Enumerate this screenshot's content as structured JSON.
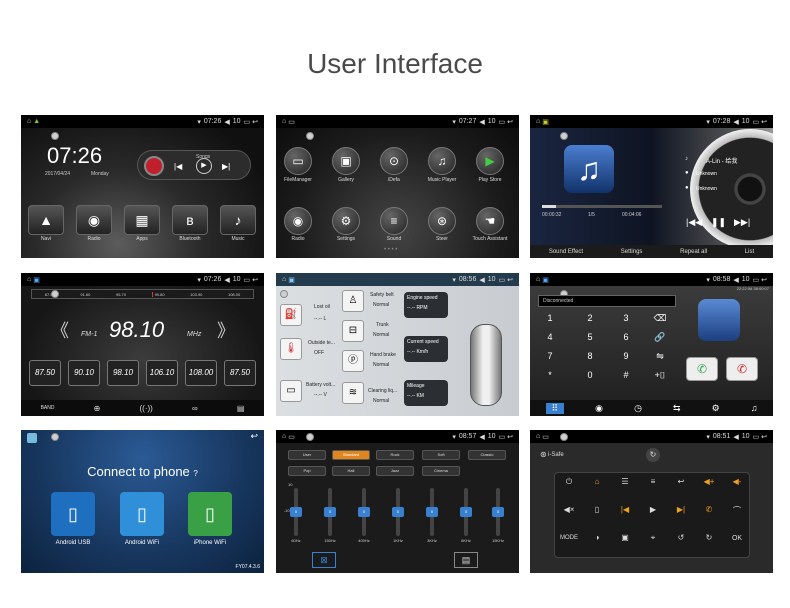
{
  "title": "User Interface",
  "colors": {
    "accent_blue": "#3a80d0",
    "call_green": "#2ea84a",
    "hangup_red": "#d02828",
    "icon_orange": "#f0a020"
  },
  "tile1": {
    "time": "07:26",
    "volume": "10",
    "clock": "07:26",
    "date": "2017/04/24",
    "day": "Monday",
    "songs_label": "Songs",
    "icons": [
      {
        "name": "navi",
        "label": "Navi",
        "glyph": "▲"
      },
      {
        "name": "radio",
        "label": "Radio",
        "glyph": "◉"
      },
      {
        "name": "apps",
        "label": "Apps",
        "glyph": "▦"
      },
      {
        "name": "bluetooth",
        "label": "Bluetooth",
        "glyph": "ʙ"
      },
      {
        "name": "music",
        "label": "Music",
        "glyph": "♪"
      }
    ]
  },
  "tile2": {
    "time": "07:27",
    "volume": "10",
    "apps_row1": [
      {
        "name": "file-manager",
        "label": "FileManager",
        "glyph": "▭"
      },
      {
        "name": "gallery",
        "label": "Gallery",
        "glyph": "▣"
      },
      {
        "name": "idrive",
        "label": "iDefa",
        "glyph": "⊙"
      },
      {
        "name": "music-player",
        "label": "Music Player",
        "glyph": "♫"
      },
      {
        "name": "play-store",
        "label": "Play Store",
        "glyph": "▶"
      }
    ],
    "apps_row2": [
      {
        "name": "radio",
        "label": "Radio",
        "glyph": "◉"
      },
      {
        "name": "settings",
        "label": "Settings",
        "glyph": "⚙"
      },
      {
        "name": "sound",
        "label": "Sound",
        "glyph": "≡"
      },
      {
        "name": "steer",
        "label": "Steer",
        "glyph": "⊛"
      },
      {
        "name": "touch-assistant",
        "label": "Touch Assistant",
        "glyph": "☚"
      }
    ]
  },
  "tile3": {
    "time": "07:28",
    "volume": "10",
    "artist": "A-Lin - 给我",
    "info1": "Unknown",
    "info2": "Unknown",
    "elapsed": "00:00:32",
    "track": "1/5",
    "duration": "00:04:06",
    "tabs": [
      "Sound Effect",
      "Settings",
      "Repeat all",
      "List"
    ]
  },
  "tile4": {
    "time": "07:26",
    "volume": "10",
    "scale": [
      "87.50",
      "91.60",
      "95.70",
      "99.80",
      "103.90",
      "108.00"
    ],
    "band": "FM-1",
    "frequency": "98.10",
    "unit": "MHz",
    "presets": [
      "87.50",
      "90.10",
      "98.10",
      "106.10",
      "108.00",
      "87.50"
    ],
    "bottom_band": "BAND"
  },
  "tile5": {
    "time": "08:56",
    "volume": "10",
    "lost_oil": "Lost oil",
    "lost_oil_val": "--.-- L",
    "outside_temp": "Outside te...",
    "outside_temp_val": "OFF",
    "battery_volt": "Battery volt...",
    "battery_volt_val": "--.-- V",
    "safety_belt": "Safety belt",
    "safety_belt_val": "Normal",
    "trunk": "Trunk",
    "trunk_val": "Normal",
    "hand_brake": "Hand brake",
    "hand_brake_val": "Normal",
    "clearing": "Clearing liq...",
    "clearing_val": "Normal",
    "engine_speed": "Engine speed",
    "engine_speed_val": "--.-- RPM",
    "current_speed": "Current speed",
    "current_speed_val": "--.-- Km/h",
    "mileage": "Mileage",
    "mileage_val": "--.-- KM"
  },
  "tile6": {
    "time": "08:58",
    "volume": "10",
    "datetime": "22:22:58 38:00:07",
    "status": "Disconnected",
    "keys": [
      "1",
      "2",
      "3",
      "⌫",
      "4",
      "5",
      "6",
      "🔗",
      "7",
      "8",
      "9",
      "⇋",
      "*",
      "0",
      "#",
      "+⌷"
    ]
  },
  "tile7": {
    "title": "Connect to phone",
    "options": [
      {
        "name": "android-usb",
        "label": "Android USB",
        "color": "#1e6fc0"
      },
      {
        "name": "android-wifi",
        "label": "Android WiFi",
        "color": "#2f8fd8"
      },
      {
        "name": "iphone-wifi",
        "label": "iPhone WiFi",
        "color": "#3aa046"
      }
    ],
    "version": "FY07.4.3.6"
  },
  "tile8": {
    "time": "08:57",
    "volume": "10",
    "presets_row1": [
      "User",
      "Standard",
      "Rock",
      "Soft",
      "Classic"
    ],
    "presets_row2": [
      "Pop",
      "Hall",
      "Jazz",
      "Cinema"
    ],
    "selected": "Standard",
    "bands": [
      "60Hz",
      "150Hz",
      "400Hz",
      "1KHz",
      "3KHz",
      "6KHz",
      "15KHz"
    ],
    "top_value": "10",
    "bottom_value": "-10",
    "level": "0"
  },
  "tile9": {
    "time": "08:51",
    "volume": "10",
    "app": "i-Safe",
    "mode": "MODE",
    "ok": "OK"
  }
}
